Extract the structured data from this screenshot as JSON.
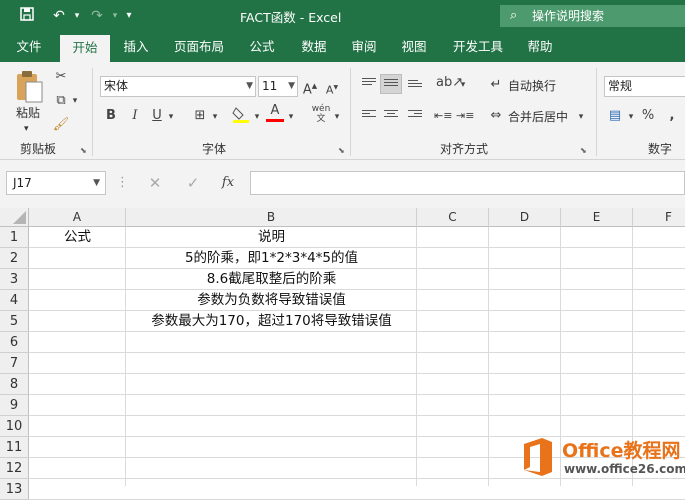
{
  "window": {
    "title": "FACT函数  -  Excel"
  },
  "quick_access": {
    "save_icon": "save-icon",
    "undo_icon": "undo-icon",
    "redo_icon": "redo-icon",
    "customize_icon": "customize-icon"
  },
  "tell_me": {
    "placeholder": "操作说明搜索"
  },
  "tabs": [
    {
      "label": "文件"
    },
    {
      "label": "开始"
    },
    {
      "label": "插入"
    },
    {
      "label": "页面布局"
    },
    {
      "label": "公式"
    },
    {
      "label": "数据"
    },
    {
      "label": "审阅"
    },
    {
      "label": "视图"
    },
    {
      "label": "开发工具"
    },
    {
      "label": "帮助"
    }
  ],
  "ribbon": {
    "clipboard": {
      "paste_label": "粘贴",
      "group_label": "剪贴板"
    },
    "font": {
      "font_name": "宋体",
      "font_size": "11",
      "bold": "B",
      "italic": "I",
      "underline": "U",
      "font_color_glyph": "A",
      "group_label": "字体"
    },
    "alignment": {
      "wrap_text": "自动换行",
      "merge_center": "合并后居中",
      "group_label": "对齐方式"
    },
    "number": {
      "format": "常规",
      "percent": "%",
      "group_label": "数字"
    }
  },
  "formula_bar": {
    "name_box": "J17",
    "fx_label": "fx",
    "value": ""
  },
  "columns": [
    "A",
    "B",
    "C",
    "D",
    "E",
    "F"
  ],
  "rows": [
    "1",
    "2",
    "3",
    "4",
    "5",
    "6",
    "7",
    "8",
    "9",
    "10",
    "11",
    "12",
    "13"
  ],
  "cells": {
    "A1": "公式",
    "B1": "说明",
    "B2": "5的阶乘，即1*2*3*4*5的值",
    "B3": "8.6截尾取整后的阶乘",
    "B4": "参数为负数将导致错误值",
    "B5": "参数最大为170，超过170将导致错误值"
  },
  "watermark": {
    "title": "Office教程网",
    "url": "www.office26.com"
  },
  "colors": {
    "excel_green": "#217346",
    "ribbon_bg": "#f3f3f3",
    "watermark_orange": "#e8731b"
  }
}
